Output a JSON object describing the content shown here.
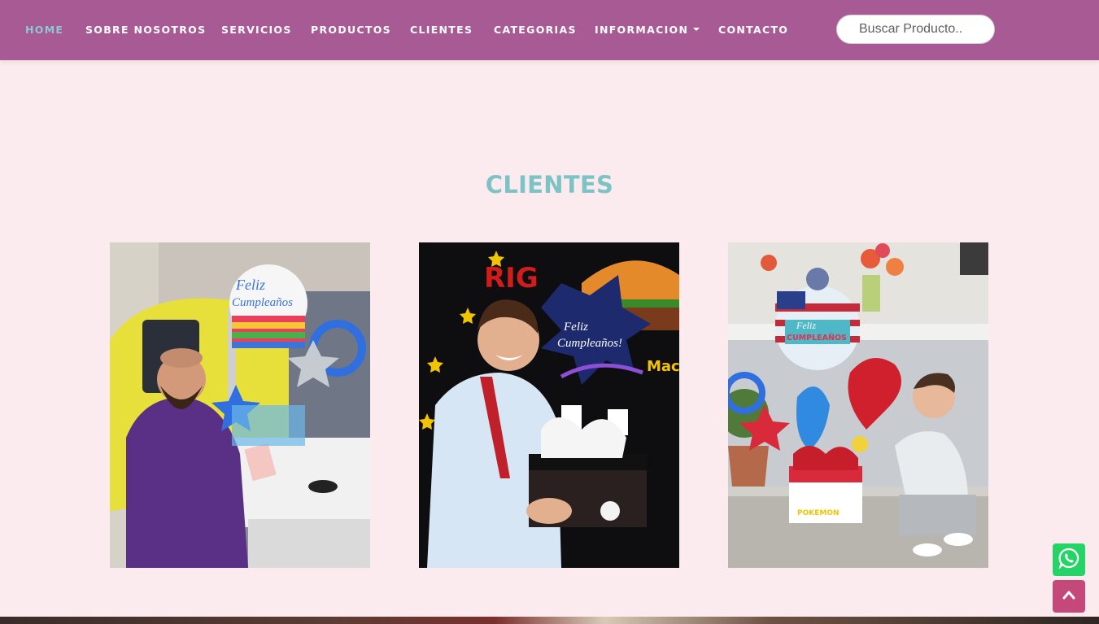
{
  "nav": {
    "items": [
      {
        "label": "HOME",
        "active": true
      },
      {
        "label": "SOBRE NOSOTROS",
        "active": false
      },
      {
        "label": "SERVICIOS",
        "active": false
      },
      {
        "label": "PRODUCTOS",
        "active": false
      },
      {
        "label": "CLIENTES",
        "active": false
      },
      {
        "label": "CATEGORIAS",
        "active": false
      },
      {
        "label": "INFORMACION",
        "active": false,
        "dropdown": true
      },
      {
        "label": "CONTACTO",
        "active": false
      }
    ],
    "search_placeholder": "Buscar Producto.."
  },
  "section": {
    "title": "CLIENTES"
  },
  "clients": {
    "photo_logo_letters": [
      "RIG",
      "Mac"
    ],
    "photo_balloon_text": [
      "Feliz Cumpleaños",
      "Feliz Cumpleaños!",
      "Feliz CUMPLEAÑOS",
      "POKEMON"
    ]
  },
  "colors": {
    "navbar": "#a85a94",
    "nav_active": "#8fc7d4",
    "page_background": "#fbeaee",
    "title": "#7cc3c6",
    "whatsapp": "#25d366",
    "back_to_top": "#c4497a"
  },
  "icons": {
    "whatsapp_button": "whatsapp-icon",
    "back_to_top_button": "chevron-up-icon",
    "dropdown": "caret-down-icon"
  }
}
